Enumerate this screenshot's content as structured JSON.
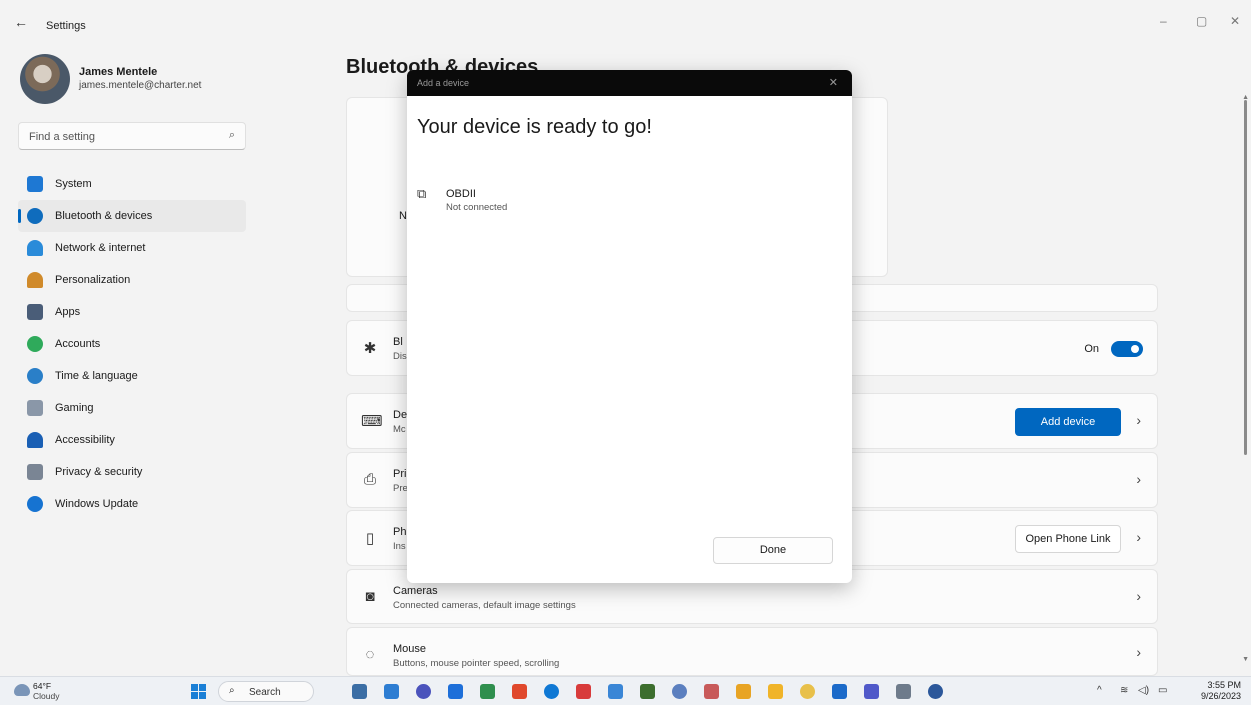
{
  "window": {
    "app_title": "Settings",
    "back": "←",
    "minimize": "–",
    "maximize": "▢",
    "close": "✕"
  },
  "profile": {
    "name": "James Mentele",
    "email": "james.mentele@charter.net"
  },
  "search": {
    "placeholder": "Find a setting",
    "icon": "⌕"
  },
  "sidebar": {
    "items": [
      {
        "label": "System",
        "icon": "system-icon",
        "color": "#1e78d3"
      },
      {
        "label": "Bluetooth & devices",
        "icon": "bluetooth-icon",
        "color": "#0f6cbd"
      },
      {
        "label": "Network & internet",
        "icon": "wifi-icon",
        "color": "#2a8bd9"
      },
      {
        "label": "Personalization",
        "icon": "brush-icon",
        "color": "#d08a2a"
      },
      {
        "label": "Apps",
        "icon": "apps-icon",
        "color": "#4a5d78"
      },
      {
        "label": "Accounts",
        "icon": "accounts-icon",
        "color": "#2faa5b"
      },
      {
        "label": "Time & language",
        "icon": "globe-icon",
        "color": "#2a7fc8"
      },
      {
        "label": "Gaming",
        "icon": "gamepad-icon",
        "color": "#8a97a8"
      },
      {
        "label": "Accessibility",
        "icon": "accessibility-icon",
        "color": "#1a5fb4"
      },
      {
        "label": "Privacy & security",
        "icon": "shield-icon",
        "color": "#7a8594"
      },
      {
        "label": "Windows Update",
        "icon": "update-icon",
        "color": "#1673d1"
      }
    ]
  },
  "main": {
    "page_title": "Bluetooth & devices",
    "hero_partial": "N",
    "bluetooth_row": {
      "title": "Bl",
      "sub": "Dis",
      "toggle_label": "On"
    },
    "devices_row": {
      "title": "De",
      "sub": "Mc",
      "button": "Add device"
    },
    "printers_row": {
      "title": "Pri",
      "sub": "Pre"
    },
    "phone_row": {
      "title": "Ph",
      "sub": "Ins",
      "button": "Open Phone Link"
    },
    "cameras_row": {
      "title": "Cameras",
      "sub": "Connected cameras, default image settings"
    },
    "mouse_row": {
      "title": "Mouse",
      "sub": "Buttons, mouse pointer speed, scrolling"
    },
    "chevron": "›"
  },
  "dialog": {
    "bar_title": "Add a device",
    "close": "✕",
    "heading": "Your device is ready to go!",
    "device_name": "OBDII",
    "device_status": "Not connected",
    "done_label": "Done"
  },
  "taskbar": {
    "temp": "64°F",
    "condition": "Cloudy",
    "search_label": "Search",
    "time": "3:55 PM",
    "date": "9/26/2023",
    "tray_chevron": "^",
    "app_colors": [
      "#3b6ea5",
      "#2d7dd2",
      "#4b53bc",
      "#1e6fd9",
      "#2f8f4e",
      "#e0482c",
      "#0f78d4",
      "#d83b3b",
      "#3a86d6",
      "#3c6e2e",
      "#5b7fbf",
      "#c85a5a",
      "#e8a424",
      "#f0b429",
      "#e8c04a",
      "#1b6ac9",
      "#5059c9",
      "#6e7b8b",
      "#2b579a"
    ]
  }
}
